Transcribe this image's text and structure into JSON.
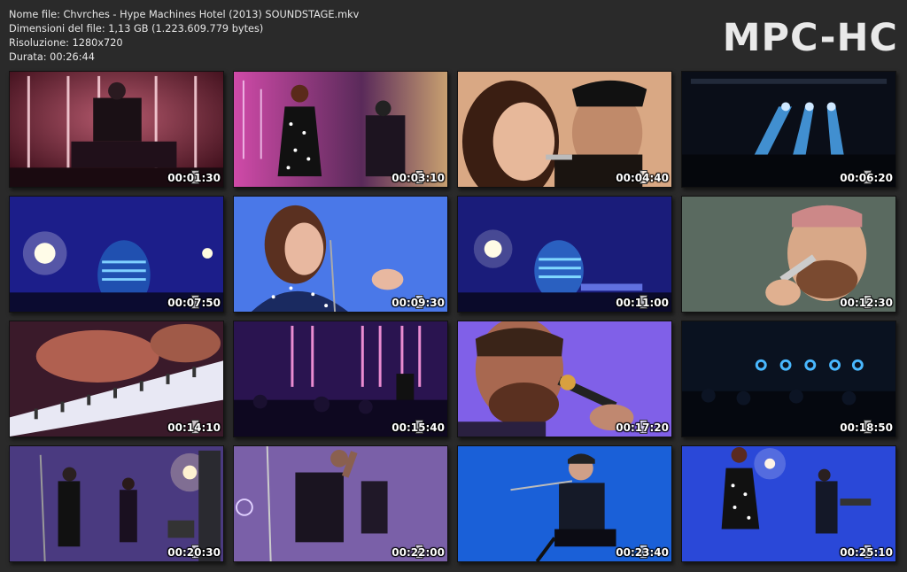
{
  "file_info": {
    "name_line": "Nome file: Chvrches - Hype Machines Hotel (2013) SOUNDSTAGE.mkv",
    "size_line": "Dimensioni del file: 1,13 GB (1.223.609.779 bytes)",
    "resolution_line": "Risoluzione: 1280x720",
    "duration_line": "Durata: 00:26:44"
  },
  "logo": "MPC-HC",
  "thumbnails": [
    {
      "time": "00:01:30",
      "scene": "scene-1"
    },
    {
      "time": "00:03:10",
      "scene": "scene-2"
    },
    {
      "time": "00:04:40",
      "scene": "scene-3"
    },
    {
      "time": "00:06:20",
      "scene": "scene-4"
    },
    {
      "time": "00:07:50",
      "scene": "scene-5"
    },
    {
      "time": "00:09:30",
      "scene": "scene-6"
    },
    {
      "time": "00:11:00",
      "scene": "scene-7"
    },
    {
      "time": "00:12:30",
      "scene": "scene-8"
    },
    {
      "time": "00:14:10",
      "scene": "scene-9"
    },
    {
      "time": "00:15:40",
      "scene": "scene-10"
    },
    {
      "time": "00:17:20",
      "scene": "scene-11"
    },
    {
      "time": "00:18:50",
      "scene": "scene-12"
    },
    {
      "time": "00:20:30",
      "scene": "scene-13"
    },
    {
      "time": "00:22:00",
      "scene": "scene-14"
    },
    {
      "time": "00:23:40",
      "scene": "scene-15"
    },
    {
      "time": "00:25:10",
      "scene": "scene-16"
    }
  ]
}
